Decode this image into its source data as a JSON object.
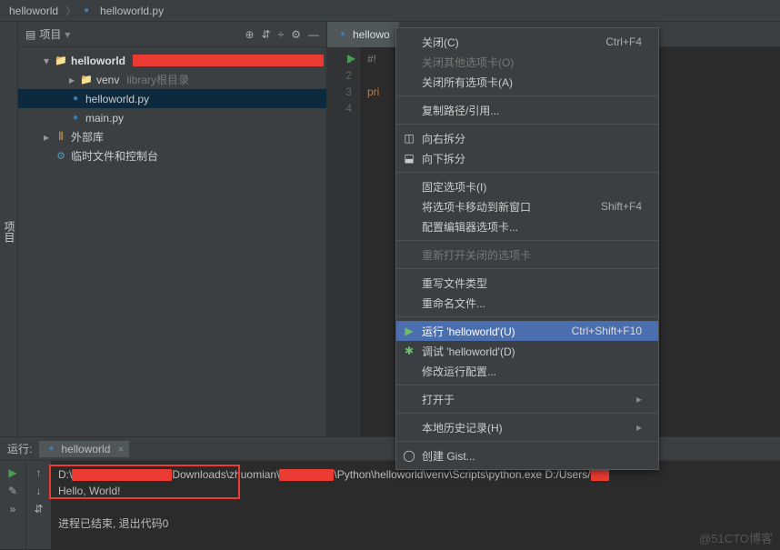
{
  "breadcrumb": {
    "project": "helloworld",
    "file": "helloworld.py"
  },
  "sidebar_tab": "项目",
  "project": {
    "title": "项目",
    "root": "helloworld",
    "venv": "venv",
    "venv_hint": "library根目录",
    "file1": "helloworld.py",
    "file2": "main.py",
    "ext_lib": "外部库",
    "scratch": "临时文件和控制台"
  },
  "editor": {
    "tab": "hellowo",
    "lines": [
      "1",
      "2",
      "3",
      "4"
    ],
    "code_l1": "#!",
    "code_l3": "pri"
  },
  "menu": {
    "close": "关闭(C)",
    "close_sc": "Ctrl+F4",
    "close_other": "关闭其他选项卡(O)",
    "close_all": "关闭所有选项卡(A)",
    "copy_path": "复制路径/引用...",
    "split_right": "向右拆分",
    "split_down": "向下拆分",
    "pin_tab": "固定选项卡(I)",
    "move_new": "将选项卡移动到新窗口",
    "move_new_sc": "Shift+F4",
    "config_editor": "配置编辑器选项卡...",
    "reopen_closed": "重新打开关闭的选项卡",
    "override_type": "重写文件类型",
    "rename_file": "重命名文件...",
    "run": "运行 'helloworld'(U)",
    "run_sc": "Ctrl+Shift+F10",
    "debug": "调试 'helloworld'(D)",
    "edit_config": "修改运行配置...",
    "open_in": "打开于",
    "local_history": "本地历史记录(H)",
    "create_gist": "创建 Gist..."
  },
  "run": {
    "title": "运行:",
    "tab": "helloworld",
    "cmd_pre": "D:\\",
    "cmd_mid": "Downloads\\zhuomian\\",
    "cmd_post": "\\Python\\helloworld\\venv\\Scripts\\python.exe D:/Users/",
    "output": "Hello, World!",
    "exit": "进程已结束, 退出代码0"
  },
  "watermark": "@51CTO博客"
}
